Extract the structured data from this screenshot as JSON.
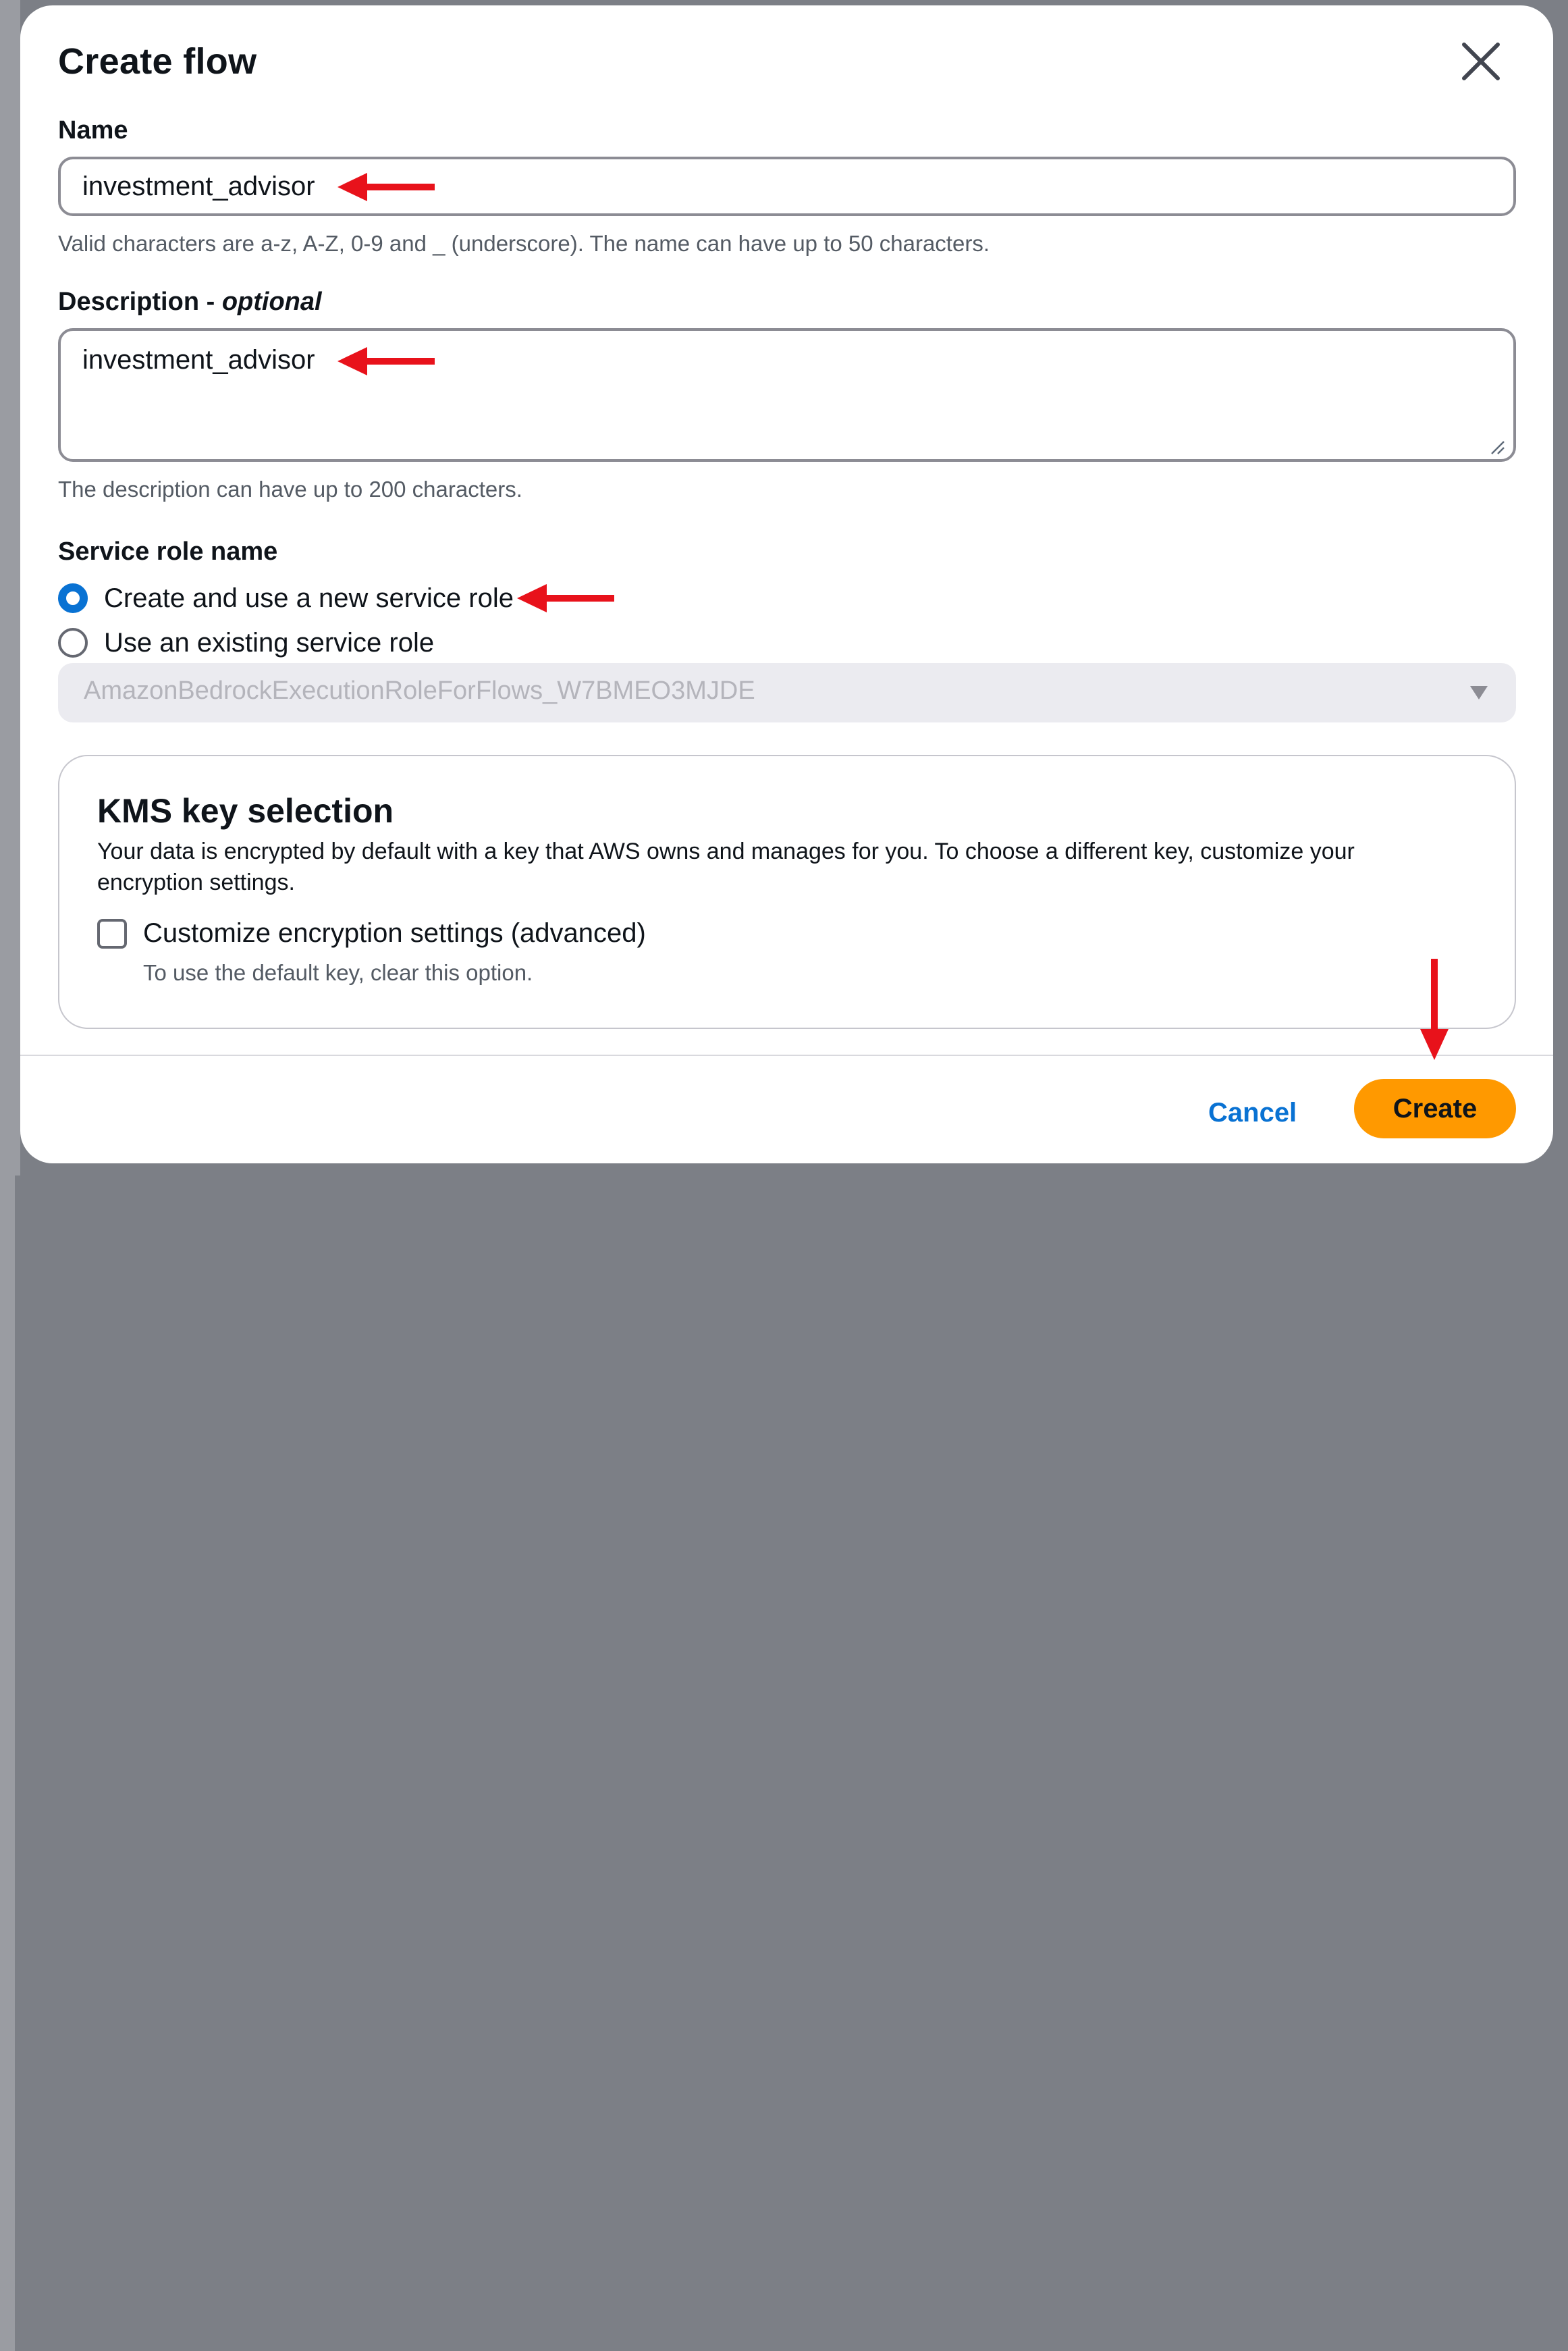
{
  "modal": {
    "title": "Create flow",
    "close_icon": "close-icon"
  },
  "name": {
    "label": "Name",
    "value": "investment_advisor",
    "hint": "Valid characters are a-z, A-Z, 0-9 and _ (underscore). The name can have up to 50 characters."
  },
  "description": {
    "label": "Description - ",
    "label_optional": "optional",
    "value": "investment_advisor",
    "hint": "The description can have up to 200 characters."
  },
  "service_role": {
    "label": "Service role name",
    "options": [
      {
        "label": "Create and use a new service role",
        "checked": true
      },
      {
        "label": "Use an existing service role",
        "checked": false
      }
    ],
    "select_value": "AmazonBedrockExecutionRoleForFlows_W7BMEO3MJDE"
  },
  "kms": {
    "title": "KMS key selection",
    "description": "Your data is encrypted by default with a key that AWS owns and manages for you. To choose a different key, customize your encryption settings.",
    "checkbox_label": "Customize encryption settings (advanced)",
    "checkbox_hint": "To use the default key, clear this option."
  },
  "footer": {
    "cancel_label": "Cancel",
    "create_label": "Create"
  },
  "colors": {
    "accent": "#0972d3",
    "primary_button": "#ff9900",
    "annotation_arrow": "#e8121b"
  }
}
